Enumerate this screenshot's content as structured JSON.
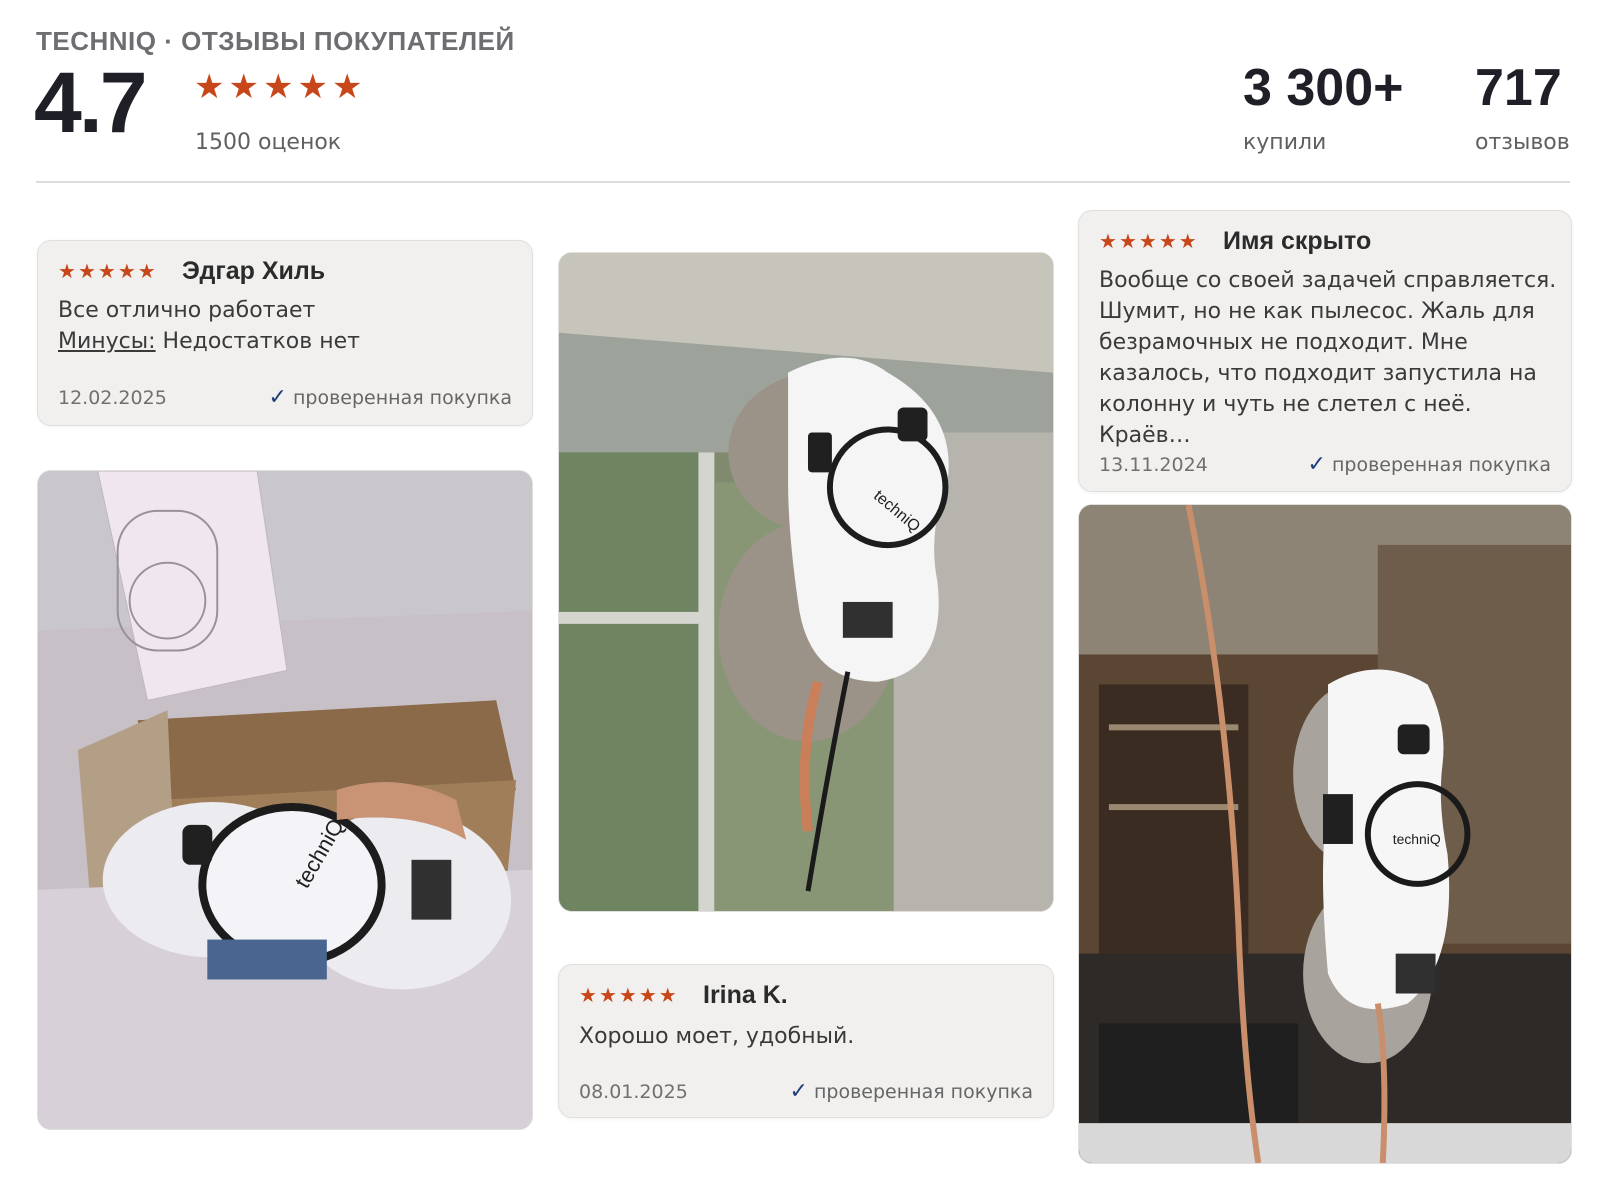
{
  "header": {
    "subtitle": "TECHNIQ · ОТЗЫВЫ ПОКУПАТЕЛЕЙ",
    "rating": "4.7",
    "stars": "★",
    "rating_count": "1500 оценок",
    "bought_value": "3 300+",
    "bought_label": "купили",
    "reviews_value": "717",
    "reviews_label": "отзывов"
  },
  "reviews": [
    {
      "stars": 5,
      "author": "Эдгар Хиль",
      "text": "Все отлично работает",
      "minus_label": "Минусы:",
      "minus_text": " Недостатков нет",
      "date": "12.02.2025",
      "verified": "проверенная покупка"
    },
    {
      "stars": 5,
      "author": "Irina K.",
      "text": "Хорошо моет, удобный.",
      "date": "08.01.2025",
      "verified": "проверенная покупка"
    },
    {
      "stars": 5,
      "author": "Имя скрыто",
      "text": "Вообще со своей задачей справляется. Шумит, но не как пылесос. Жаль для безрамочных не подходит. Мне казалось, что подходит запустила на колонну и чуть не слетел с неё. Краёв…",
      "date": "13.11.2024",
      "verified": "проверенная покупка"
    }
  ],
  "photos": {
    "box_brand": "techniQ",
    "window_brand": "techniQ",
    "porch_brand": "techniQ"
  },
  "colors": {
    "star": "#c8471a",
    "check": "#1f3f7a",
    "card_bg": "#f1f0ee"
  }
}
